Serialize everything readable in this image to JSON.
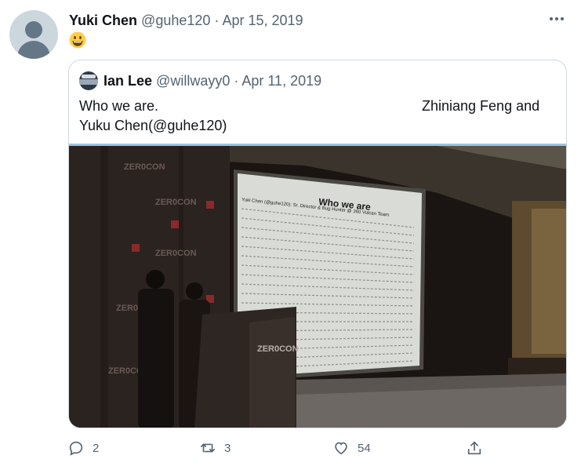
{
  "tweet": {
    "author_name": "Yuki Chen",
    "handle": "@guhe120",
    "separator": "·",
    "date": "Apr 15, 2019",
    "emoji_name": "smiling-face-icon"
  },
  "quoted": {
    "author_name": "Ian Lee",
    "handle": "@willwayy0",
    "separator": "·",
    "date": "Apr 11, 2019",
    "text_line1": "Who we are.",
    "text_line1_right": "Zhiniang Feng and",
    "text_line2": "Yuku Chen(@guhe120)",
    "photo": {
      "slide_title": "Who we are",
      "slide_subtitle": "Yuki Chen (@guhe120): Sr. Director & Bug Hunter @ 360 Vulcan Team",
      "brand": "ZER0CON"
    }
  },
  "actions": {
    "reply_count": "2",
    "retweet_count": "3",
    "like_count": "54"
  },
  "colors": {
    "text": "#0f1419",
    "secondary": "#536471",
    "border": "#cfd9de",
    "accent_line": "#9dc3de"
  }
}
